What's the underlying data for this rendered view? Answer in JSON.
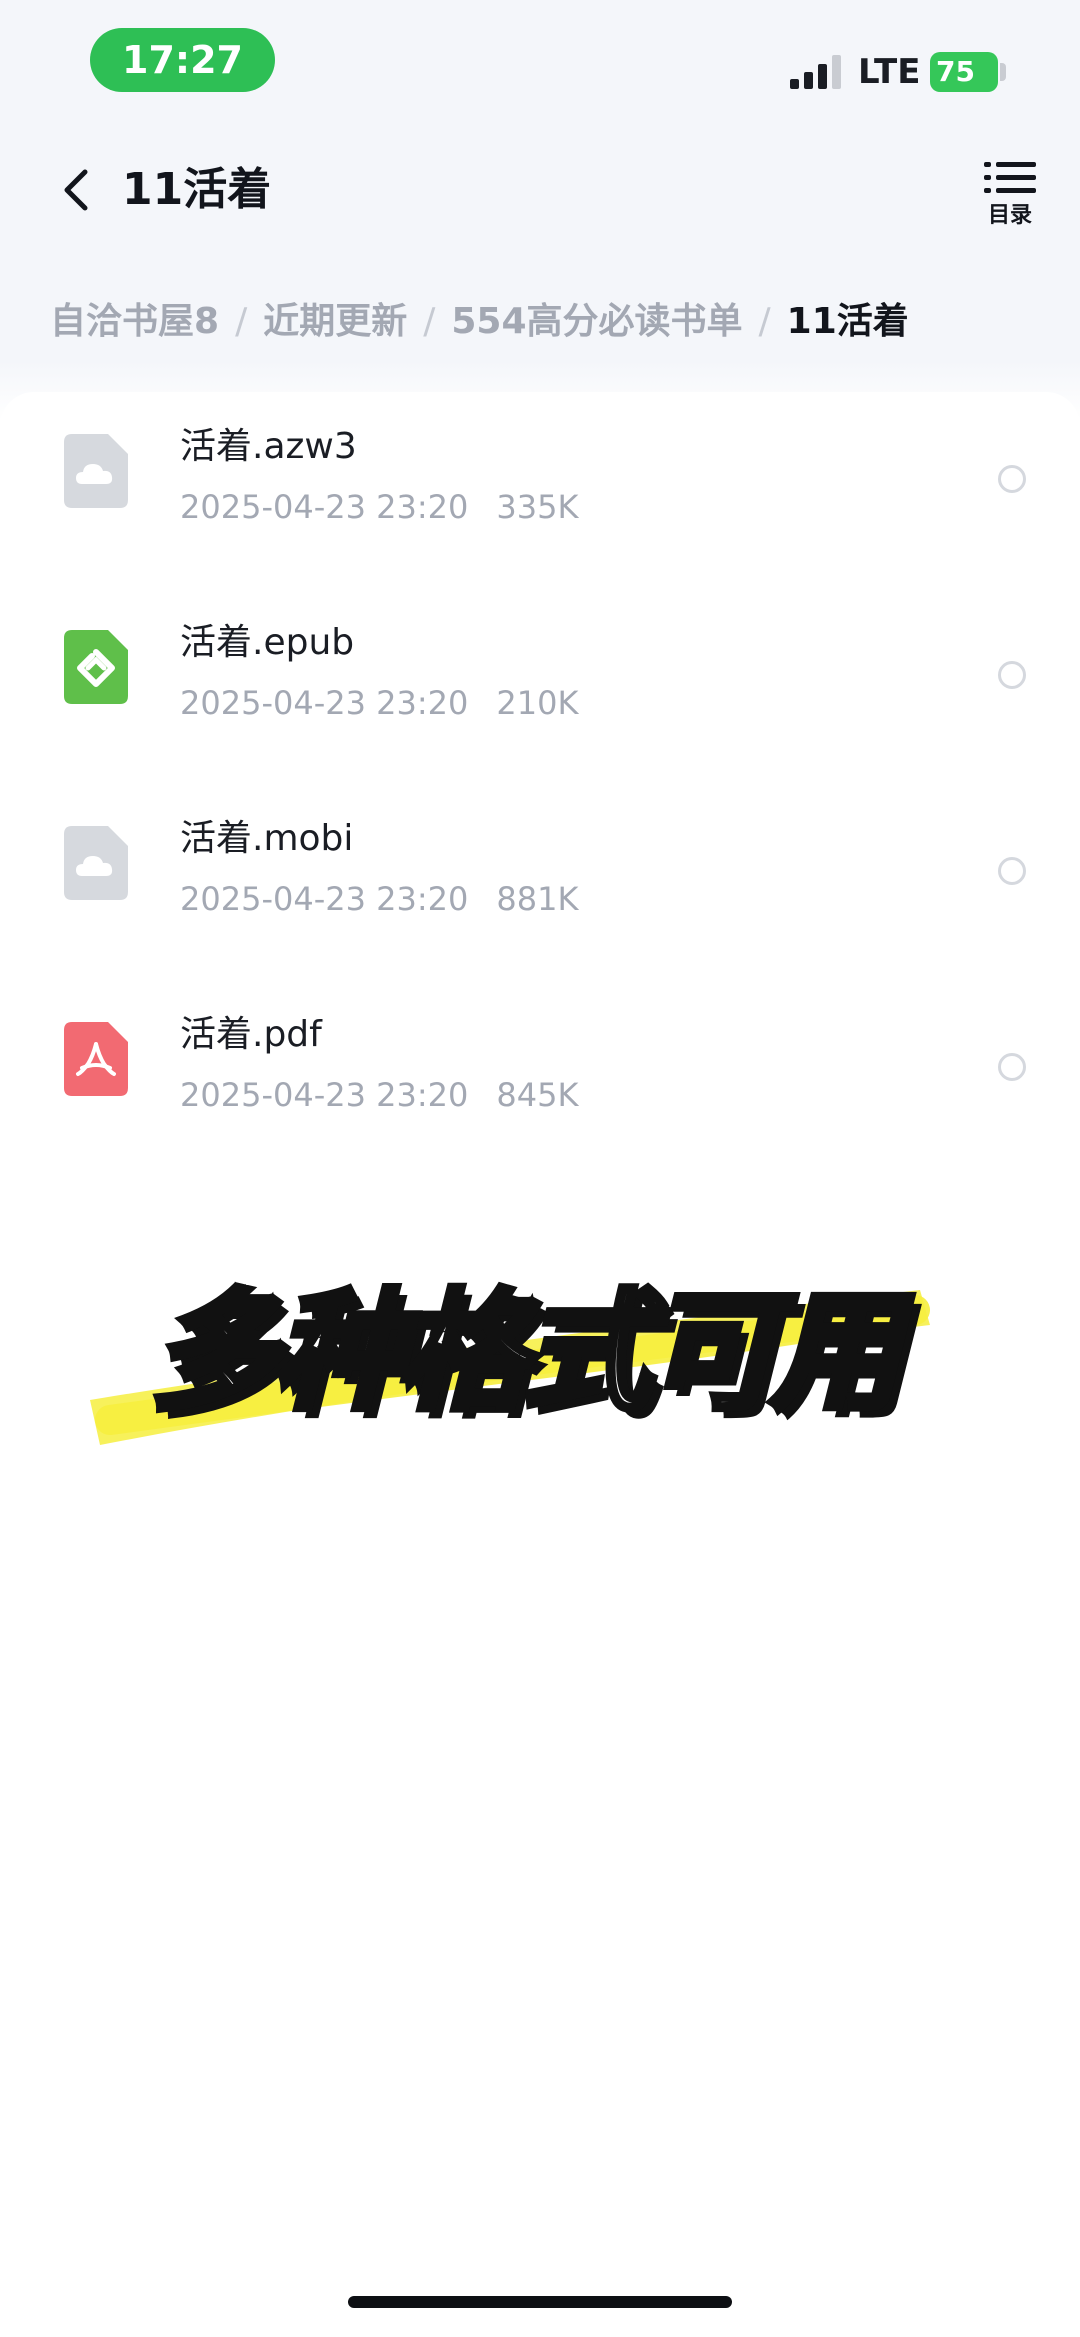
{
  "status_bar": {
    "time": "17:27",
    "network": "LTE",
    "battery": "75",
    "colors": {
      "time_pill": "#2ebf55",
      "battery": "#35c759"
    }
  },
  "header": {
    "title": "11活着",
    "back_icon": "chevron-left-icon",
    "toc_icon": "list-icon",
    "toc_label": "目录"
  },
  "breadcrumb": [
    {
      "label": "自洽书屋8"
    },
    {
      "label": "近期更新"
    },
    {
      "label": "554高分必读书单"
    },
    {
      "label": "11活着"
    }
  ],
  "files": [
    {
      "name": "活着.azw3",
      "date": "2025-04-23 23:20",
      "size": "335K",
      "icon": "cloud-file-icon",
      "color": "#d6d9de"
    },
    {
      "name": "活着.epub",
      "date": "2025-04-23 23:20",
      "size": "210K",
      "icon": "epub-file-icon",
      "color": "#5fbf4a"
    },
    {
      "name": "活着.mobi",
      "date": "2025-04-23 23:20",
      "size": "881K",
      "icon": "cloud-file-icon",
      "color": "#d6d9de"
    },
    {
      "name": "活着.pdf",
      "date": "2025-04-23 23:20",
      "size": "845K",
      "icon": "pdf-file-icon",
      "color": "#f26a72"
    }
  ],
  "caption": {
    "text": "多种格式可用",
    "highlight_color": "#f6ee3e"
  }
}
